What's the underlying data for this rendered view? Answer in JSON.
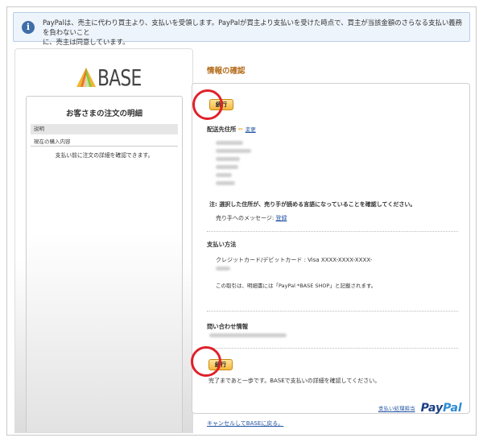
{
  "notice": {
    "line1": "PayPalは、売主に代わり買主より、支払いを受領します。PayPalが買主より支払いを受けた時点で、買主が当該金額のさらなる支払い義務を負わないこと",
    "line2": "に、売主は同意しています。"
  },
  "left": {
    "logo_text": "BASE",
    "order_title": "お客さまの注文の明細",
    "description_label": "説明",
    "current_items_label": "現在の購入内容",
    "confirm_note": "支払い前に注文の詳細を確認できます。"
  },
  "right": {
    "title": "情報の確認",
    "continue_top": "続行",
    "shipping_label": "配送先住所",
    "change_link": "変更",
    "shipping_note": "注: 選択した住所が、売り手が読める言語になっていることを確認してください。",
    "seller_message_label": "売り手へのメッセージ:",
    "register_link": "登録",
    "payment_method_label": "支払い方法",
    "card_text": "クレジットカード/デビットカード : Visa XXXX-XXXX-XXXX-",
    "statement_note": "この取引は、明細書には「PayPal *BASE SHOP」と記載されます。",
    "contact_label": "問い合わせ情報",
    "continue_bottom": "続行",
    "finish_note": "完了まであと一歩です。BASEで支払いの詳細を確認してください。",
    "paypal_small": "支払い処理担当",
    "paypal_logo_a": "Pay",
    "paypal_logo_b": "Pal"
  },
  "cancel_link": "キャンセルしてBASEに戻る。",
  "colors": {
    "accent": "#b46c1b",
    "highlight_ring": "#e0202a",
    "button": "#f6b73c",
    "link": "#2152a3"
  }
}
